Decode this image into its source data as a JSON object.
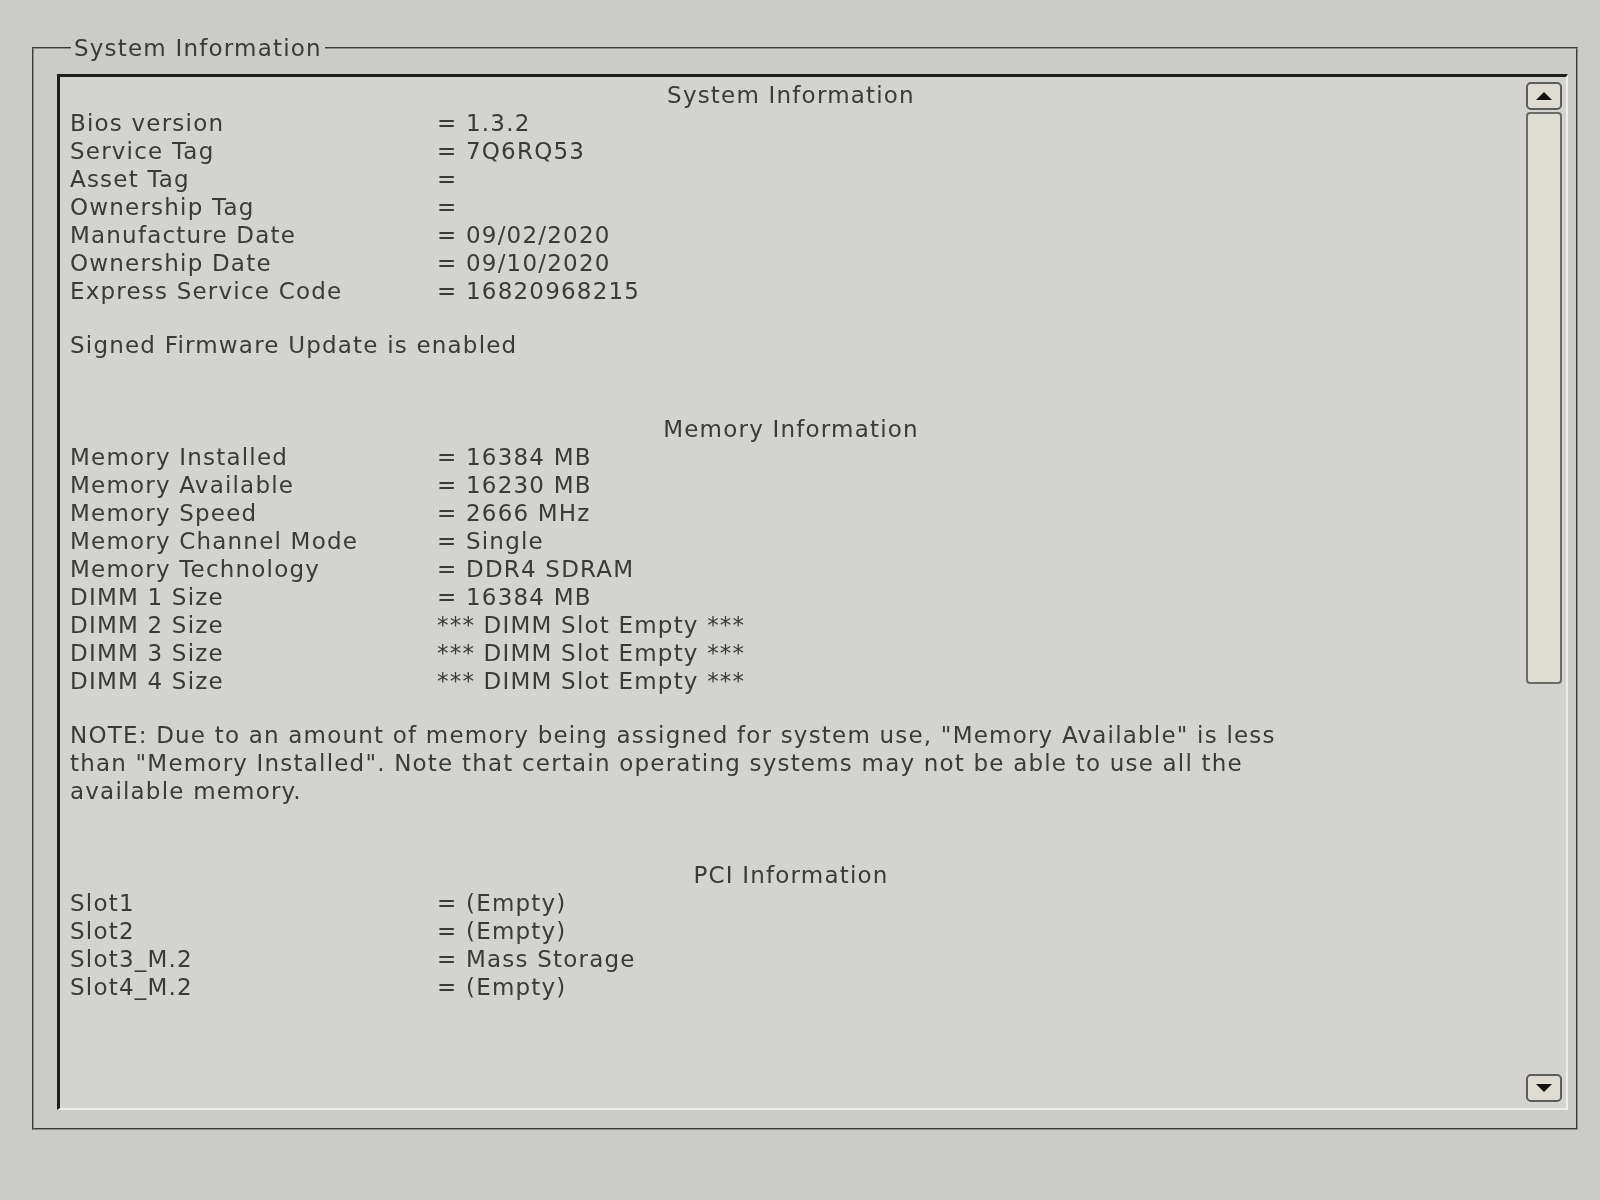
{
  "group_title": "System Information",
  "sections": [
    {
      "heading": "System Information",
      "rows": [
        {
          "label": "Bios version",
          "value": "= 1.3.2"
        },
        {
          "label": "Service Tag",
          "value": "= 7Q6RQ53"
        },
        {
          "label": "Asset Tag",
          "value": "="
        },
        {
          "label": "Ownership Tag",
          "value": "="
        },
        {
          "label": "Manufacture Date",
          "value": "= 09/02/2020"
        },
        {
          "label": "Ownership Date",
          "value": "= 09/10/2020"
        },
        {
          "label": "Express Service Code",
          "value": "= 16820968215"
        }
      ],
      "notes": [
        "Signed Firmware Update is enabled"
      ]
    },
    {
      "heading": "Memory Information",
      "rows": [
        {
          "label": "Memory Installed",
          "value": "= 16384 MB"
        },
        {
          "label": "Memory Available",
          "value": "= 16230 MB"
        },
        {
          "label": "Memory Speed",
          "value": "= 2666 MHz"
        },
        {
          "label": "Memory Channel Mode",
          "value": "= Single"
        },
        {
          "label": "Memory Technology",
          "value": "= DDR4 SDRAM"
        },
        {
          "label": "DIMM 1 Size",
          "value": "= 16384 MB"
        },
        {
          "label": "DIMM 2 Size",
          "value": "*** DIMM Slot Empty ***"
        },
        {
          "label": "DIMM 3 Size",
          "value": "*** DIMM Slot Empty ***"
        },
        {
          "label": "DIMM 4 Size",
          "value": "*** DIMM Slot Empty ***"
        }
      ],
      "notes": [
        "NOTE: Due to an amount of memory being assigned for system use, \"Memory Available\" is less than \"Memory Installed\". Note that certain operating systems may not be able to use all the available memory."
      ]
    },
    {
      "heading": "PCI Information",
      "rows": [
        {
          "label": "Slot1",
          "value": "= (Empty)"
        },
        {
          "label": "Slot2",
          "value": "= (Empty)"
        },
        {
          "label": "Slot3_M.2",
          "value": "= Mass Storage"
        },
        {
          "label": "Slot4_M.2",
          "value": "= (Empty)"
        }
      ]
    }
  ]
}
